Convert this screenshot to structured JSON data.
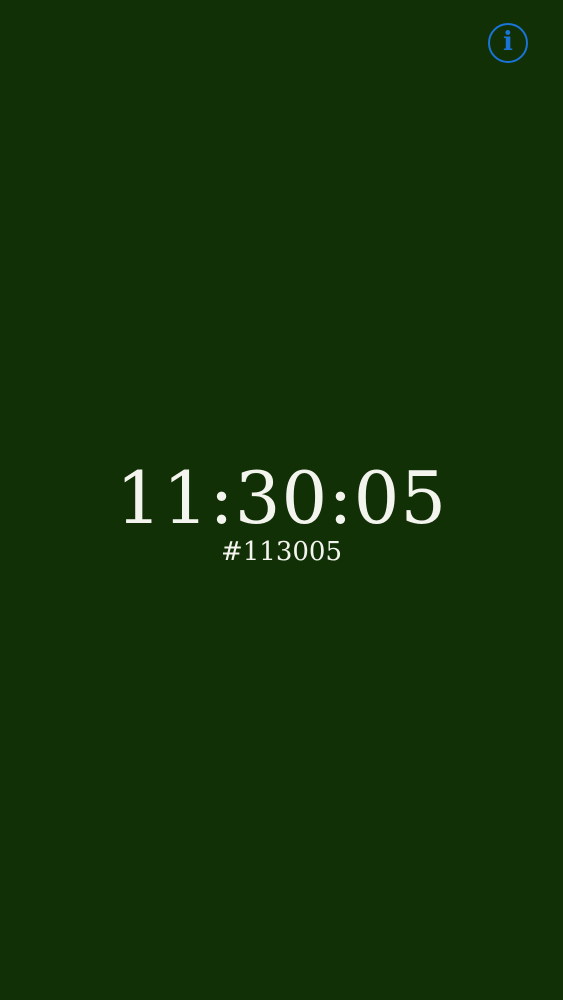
{
  "colors": {
    "background": "#113005",
    "text": "#f4f4ef",
    "accent": "#1a74d8"
  },
  "info_button": {
    "icon": "info-icon",
    "glyph": "i"
  },
  "clock": {
    "time": "11:30:05",
    "hex": "#113005"
  }
}
